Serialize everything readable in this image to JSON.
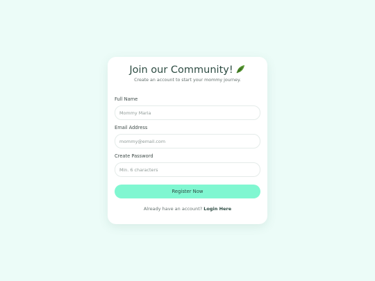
{
  "form": {
    "title": "Join our Community!",
    "title_icon": "leaf-icon",
    "subtitle": "Create an account to start your mommy journey.",
    "fields": [
      {
        "label": "Full Name",
        "value": "",
        "placeholder": "Mommy Maria"
      },
      {
        "label": "Email Address",
        "value": "",
        "placeholder": "mommy@email.com"
      },
      {
        "label": "Create Password",
        "value": "",
        "placeholder": "Min. 6 characters"
      }
    ],
    "submit_label": "Register Now",
    "footer_text": "Already have an account?",
    "login_link": "Login Here"
  },
  "colors": {
    "background": "#ecfcf8",
    "card": "#ffffff",
    "accent": "#80f7d1",
    "title_text": "#2f4d44",
    "leaf": "#4f8a2f"
  }
}
